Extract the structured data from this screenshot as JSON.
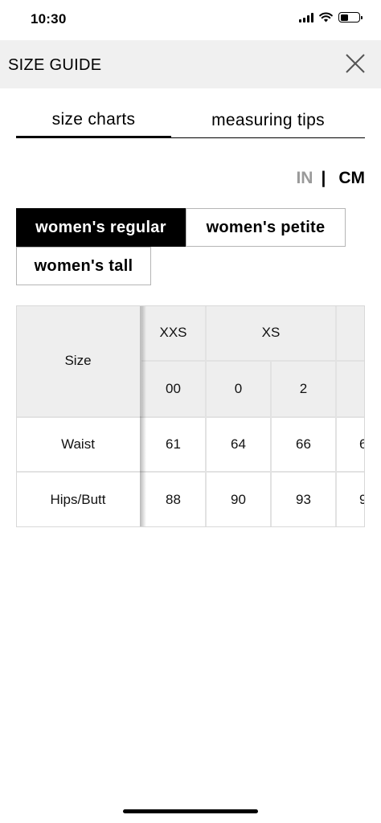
{
  "status_bar": {
    "time": "10:30"
  },
  "header": {
    "title": "SIZE GUIDE",
    "close_icon": "close-icon"
  },
  "tabs": [
    {
      "label": "size charts",
      "active": true
    },
    {
      "label": "measuring tips",
      "active": false
    }
  ],
  "units": {
    "in_label": "IN",
    "separator": "|",
    "cm_label": "CM",
    "selected": "CM"
  },
  "fits": [
    {
      "label": "women's regular",
      "selected": true
    },
    {
      "label": "women's petite",
      "selected": false
    },
    {
      "label": "women's tall",
      "selected": false
    }
  ],
  "table": {
    "row_header_label": "Size",
    "size_groups": [
      "XXS",
      "XS",
      ""
    ],
    "sizes": [
      "00",
      "0",
      "2",
      ""
    ],
    "rows": [
      {
        "label": "Waist",
        "values": [
          "61",
          "64",
          "66",
          "6"
        ]
      },
      {
        "label": "Hips/Butt",
        "values": [
          "88",
          "90",
          "93",
          "9"
        ]
      }
    ]
  },
  "colors": {
    "accent": "#000000",
    "shade": "#eeeeee",
    "muted": "#9a9a9a"
  }
}
